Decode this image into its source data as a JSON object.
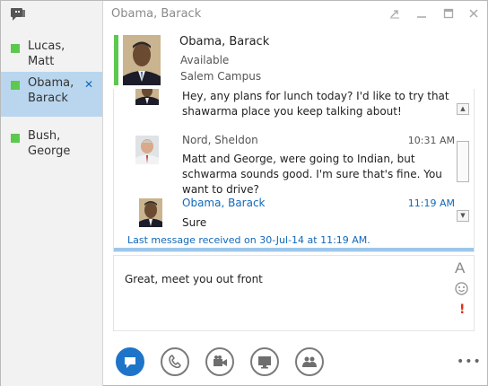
{
  "window": {
    "title": "Obama, Barack"
  },
  "conversations": [
    {
      "name": "Lucas,\nMatt",
      "line1": "Lucas,",
      "line2": "Matt",
      "presence_color": "#5cc84f",
      "active": false
    },
    {
      "name": "Obama,\nBarack",
      "line1": "Obama,",
      "line2": "Barack",
      "presence_color": "#5cc84f",
      "active": true
    },
    {
      "name": "Bush,\nGeorge",
      "line1": "Bush,",
      "line2": "George",
      "presence_color": "#5cc84f",
      "active": false
    }
  ],
  "contact": {
    "name": "Obama, Barack",
    "status": "Available",
    "location": "Salem Campus",
    "presence_color": "#5cc84f"
  },
  "messages": [
    {
      "sender": "",
      "time": "",
      "text": "Hey, any plans for lunch today? I'd like to try that shawarma place you keep talking about!"
    },
    {
      "sender": "Nord, Sheldon",
      "time": "10:31 AM",
      "text": "Matt and George, were going to Indian, but schwarma sounds good. I'm sure that's fine. You want to drive?"
    },
    {
      "sender": "Obama, Barack",
      "time": "11:19 AM",
      "text": "Sure"
    }
  ],
  "last_received": "Last message received on 30-Jul-14 at 11:19 AM.",
  "compose": {
    "value": "Great, meet you out front",
    "format_label": "A",
    "important_label": "!"
  },
  "toolbar": {
    "buttons": [
      {
        "name": "im",
        "icon": "chat-bubble-icon"
      },
      {
        "name": "call",
        "icon": "phone-icon"
      },
      {
        "name": "video",
        "icon": "video-camera-icon"
      },
      {
        "name": "present",
        "icon": "monitor-icon"
      },
      {
        "name": "participants",
        "icon": "people-icon"
      }
    ],
    "more_label": "•••"
  },
  "colors": {
    "accent": "#1e74c8",
    "link": "#1168ba",
    "available": "#5cc84f",
    "active_tab": "#b9d6ee"
  }
}
